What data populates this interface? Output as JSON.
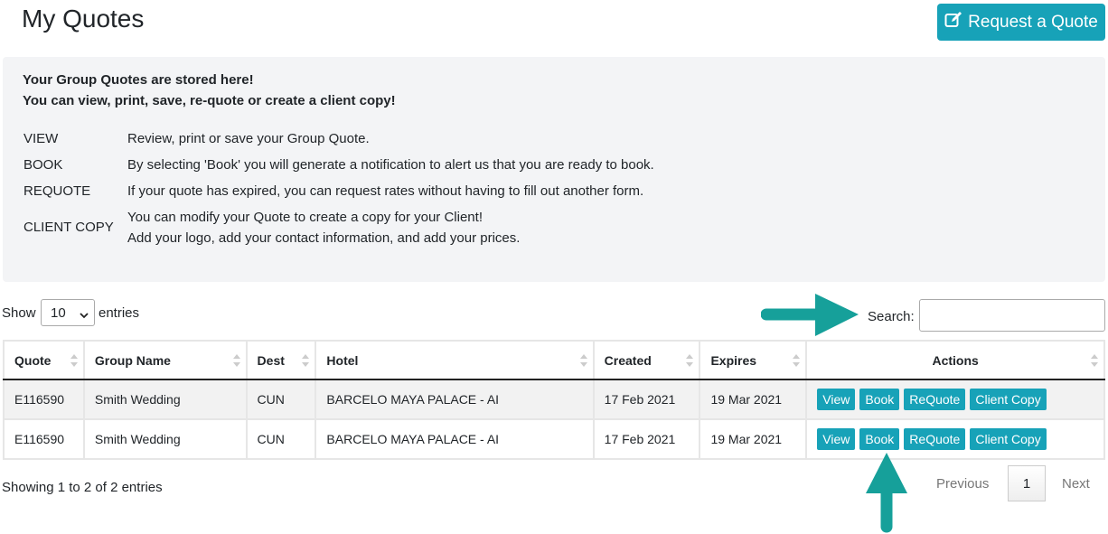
{
  "header": {
    "title": "My Quotes",
    "request_label": "Request a Quote",
    "accent_color": "#17a2b8"
  },
  "info": {
    "line1": "Your Group Quotes are stored here!",
    "line2": "You can view, print, save, re-quote or create a client copy!",
    "definitions": [
      {
        "term": "VIEW",
        "desc": [
          "Review, print or save your Group Quote."
        ]
      },
      {
        "term": "BOOK",
        "desc": [
          "By selecting 'Book' you will generate a notification to alert us that you are ready to book."
        ]
      },
      {
        "term": "REQUOTE",
        "desc": [
          "If your quote has expired, you can request rates without having to fill out another form."
        ]
      },
      {
        "term": "CLIENT COPY",
        "desc": [
          "You can modify your Quote to create a copy for your Client!",
          "Add your logo, add your contact information, and add your prices."
        ]
      }
    ]
  },
  "controls": {
    "show_label": "Show",
    "entries_value": "10",
    "entries_label": "entries",
    "search_label": "Search:",
    "search_value": ""
  },
  "table": {
    "headers": [
      "Quote",
      "Group Name",
      "Dest",
      "Hotel",
      "Created",
      "Expires",
      "Actions"
    ],
    "rows": [
      {
        "quote": "E116590",
        "group": "Smith Wedding",
        "dest": "CUN",
        "hotel": "BARCELO MAYA PALACE - AI",
        "created": "17 Feb 2021",
        "expires": "19 Mar 2021"
      },
      {
        "quote": "E116590",
        "group": "Smith Wedding",
        "dest": "CUN",
        "hotel": "BARCELO MAYA PALACE - AI",
        "created": "17 Feb 2021",
        "expires": "19 Mar 2021"
      }
    ],
    "action_labels": {
      "view": "View",
      "book": "Book",
      "requote": "ReQuote",
      "client_copy": "Client Copy"
    }
  },
  "footer": {
    "showing": "Showing 1 to 2 of 2 entries",
    "previous": "Previous",
    "current_page": "1",
    "next": "Next"
  }
}
